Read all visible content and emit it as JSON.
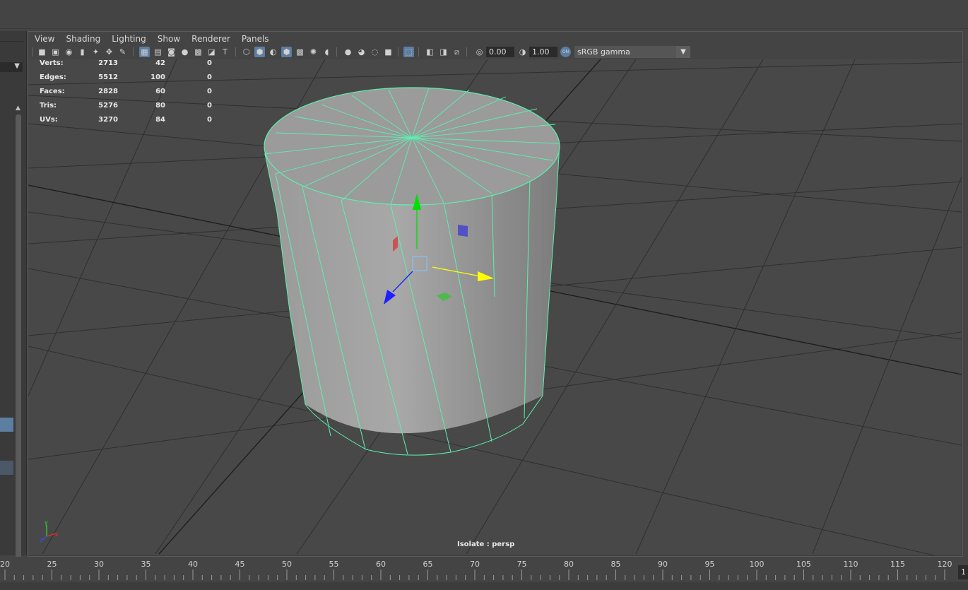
{
  "viewport_menu": [
    "View",
    "Shading",
    "Lighting",
    "Show",
    "Renderer",
    "Panels"
  ],
  "toolbar": {
    "exposure_value": "0.00",
    "gamma_value": "1.00",
    "color_space": "sRGB gamma",
    "color_management_badge": "ON"
  },
  "hud_stats": [
    {
      "label": "Verts:",
      "scene": "2713",
      "selected": "42",
      "components": "0"
    },
    {
      "label": "Edges:",
      "scene": "5512",
      "selected": "100",
      "components": "0"
    },
    {
      "label": "Faces:",
      "scene": "2828",
      "selected": "60",
      "components": "0"
    },
    {
      "label": "Tris:",
      "scene": "5276",
      "selected": "80",
      "components": "0"
    },
    {
      "label": "UVs:",
      "scene": "3270",
      "selected": "84",
      "components": "0"
    }
  ],
  "isolate_label": "Isolate : persp",
  "axis_labels": {
    "x": "x",
    "y": "y",
    "z": "z"
  },
  "timeline": {
    "tick_labels": [
      "20",
      "25",
      "30",
      "35",
      "40",
      "45",
      "50",
      "55",
      "60",
      "65",
      "70",
      "75",
      "80",
      "85",
      "90",
      "95",
      "100",
      "105",
      "110",
      "115",
      "120"
    ],
    "current_frame": "1"
  },
  "colors": {
    "viewport_bg": "#3d3d3d",
    "wireframe_highlight": "#5cf0b0",
    "selection_blue": "#5d7ea1",
    "move_x": "#ffff00",
    "move_y": "#00e000",
    "move_z": "#1f1fff"
  }
}
